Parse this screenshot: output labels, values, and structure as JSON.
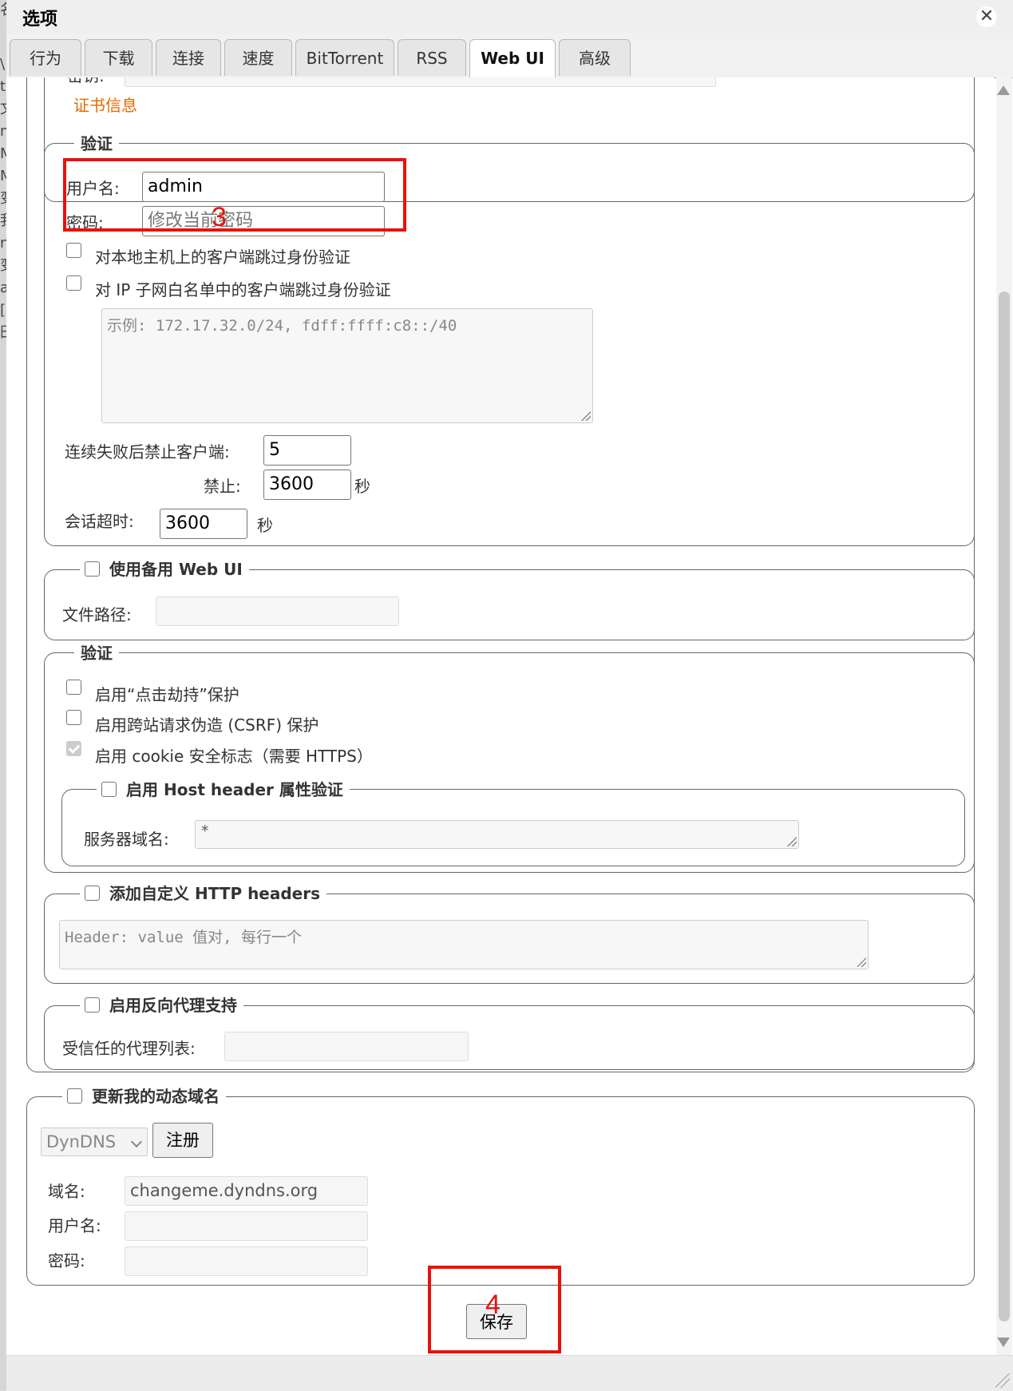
{
  "window": {
    "title": "选项",
    "close_glyph": "✕"
  },
  "tabs": [
    "行为",
    "下载",
    "连接",
    "速度",
    "BitTorrent",
    "RSS",
    "Web UI",
    "高级"
  ],
  "active_tab": "Web UI",
  "https": {
    "partial_label": "密钥:",
    "cert_info_link": "证书信息"
  },
  "auth": {
    "legend": "验证",
    "username_label": "用户名:",
    "username_value": "admin",
    "password_label": "密码:",
    "password_placeholder": "修改当前密码",
    "bypass_local": "对本地主机上的客户端跳过身份验证",
    "bypass_whitelist": "对 IP 子网白名单中的客户端跳过身份验证",
    "whitelist_placeholder": "示例: 172.17.32.0/24, fdff:ffff:c8::/40",
    "ban_after_label": "连续失败后禁止客户端:",
    "ban_after_value": "5",
    "ban_for_label": "禁止:",
    "ban_for_value": "3600",
    "ban_unit": "秒",
    "session_timeout_label": "会话超时:",
    "session_timeout_value": "3600",
    "session_unit": "秒"
  },
  "alt_webui": {
    "legend": "使用备用 Web UI",
    "file_path_label": "文件路径:"
  },
  "security": {
    "legend": "验证",
    "clickjacking": "启用“点击劫持”保护",
    "csrf": "启用跨站请求伪造 (CSRF) 保护",
    "cookie_secure": "启用 cookie 安全标志（需要 HTTPS）",
    "host_header_legend": "启用 Host header 属性验证",
    "server_domain_label": "服务器域名:",
    "server_domain_value": "*"
  },
  "custom_headers": {
    "legend": "添加自定义 HTTP headers",
    "placeholder": "Header: value 值对, 每行一个"
  },
  "reverse_proxy": {
    "legend": "启用反向代理支持",
    "trusted_label": "受信任的代理列表:"
  },
  "dyndns": {
    "legend": "更新我的动态域名",
    "service": "DynDNS",
    "register_button": "注册",
    "domain_label": "域名:",
    "domain_value": "changeme.dyndns.org",
    "username_label": "用户名:",
    "password_label": "密码:"
  },
  "save_button": "保存",
  "annotations": {
    "box3": "3",
    "box4": "4",
    "color": "#e8120c"
  },
  "background_chars": [
    "名",
    "\\",
    "ta",
    "文",
    "n",
    "M",
    "M",
    "变",
    "我",
    "n",
    "变",
    "a",
    "[",
    "田"
  ]
}
